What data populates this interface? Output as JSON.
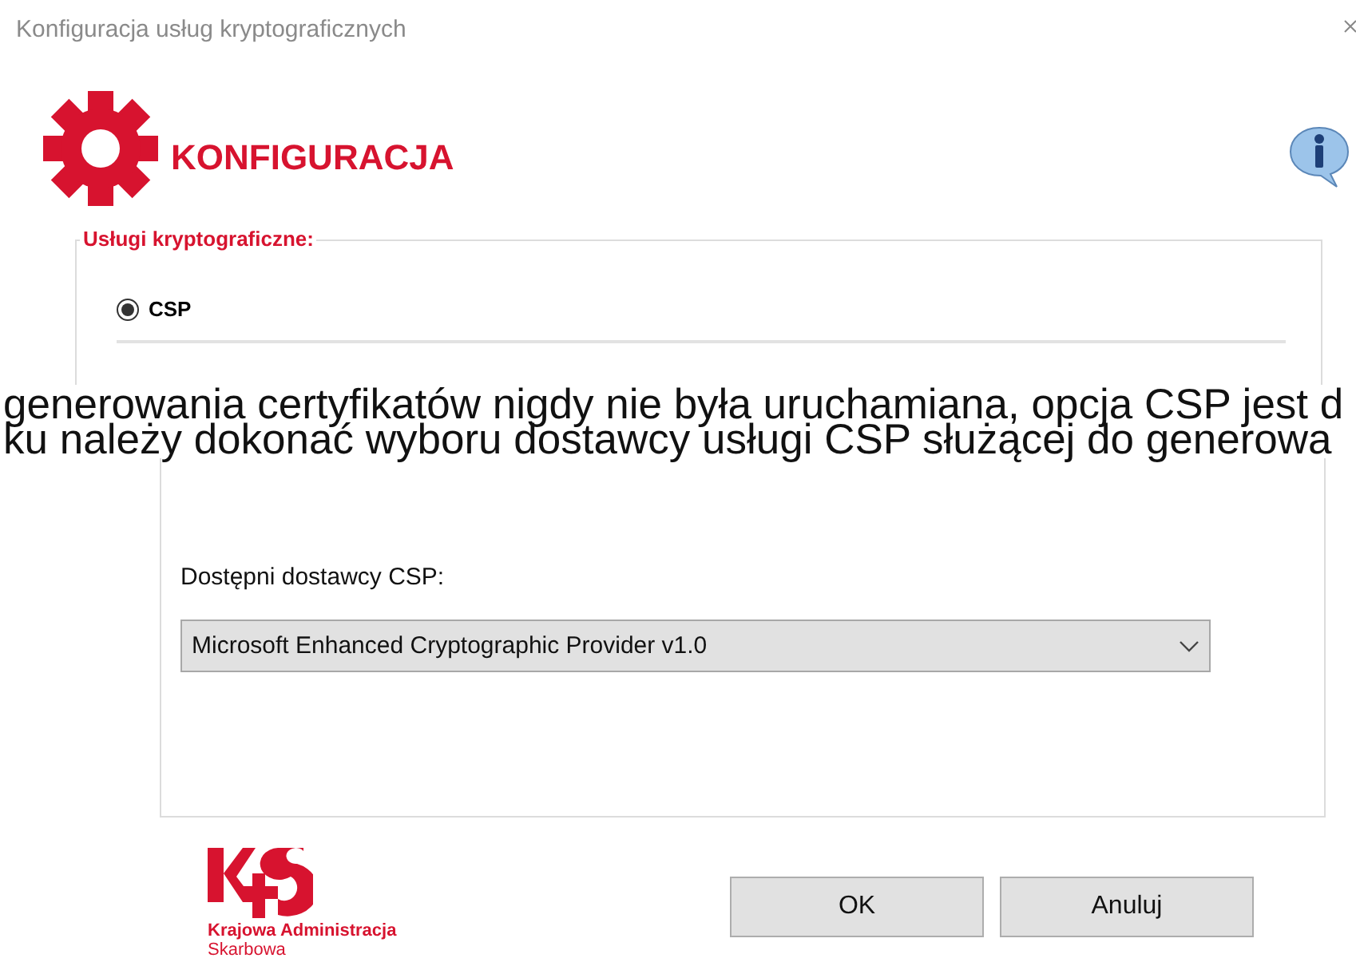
{
  "window": {
    "title": "Konfiguracja usług kryptograficznych"
  },
  "header": {
    "title": "KONFIGURACJA"
  },
  "services_group": {
    "legend": "Usługi kryptograficzne:",
    "options": [
      {
        "label": "CSP",
        "selected": true
      }
    ]
  },
  "overlay_lines": [
    "generowania certyfikatów nigdy nie była uruchamiana, opcja CSP jest d",
    "ku należy dokonać wyboru dostawcy usługi CSP służącej do generowa"
  ],
  "providers": {
    "label": "Dostępni dostawcy CSP:",
    "value": "Microsoft Enhanced Cryptographic Provider v1.0"
  },
  "logo": {
    "line_1": "Krajowa Administracja",
    "line_2": "Skarbowa"
  },
  "buttons": [
    "OK",
    "Anuluj"
  ]
}
